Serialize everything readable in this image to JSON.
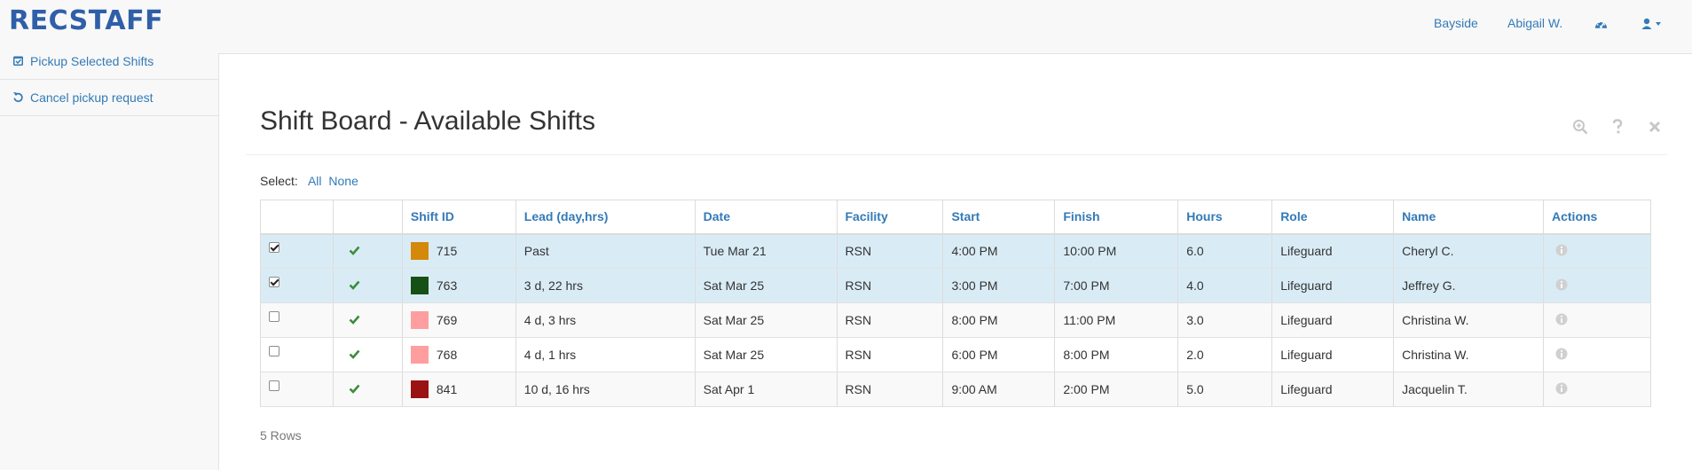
{
  "brand": "RECSTAFF",
  "nav": {
    "location": "Bayside",
    "user": "Abigail W."
  },
  "icons": {
    "pickup": "calendar-check-icon",
    "cancel": "undo-icon",
    "dashboard": "dashboard-icon",
    "user": "user-icon",
    "zoom": "zoom-in-icon",
    "help": "question-icon",
    "close": "close-icon",
    "check": "checkmark-icon",
    "info": "info-icon"
  },
  "sidebar": {
    "items": [
      {
        "label": "Pickup Selected Shifts"
      },
      {
        "label": "Cancel pickup request"
      }
    ]
  },
  "page": {
    "title": "Shift Board - Available Shifts",
    "select_label": "Select:",
    "select_all": "All",
    "select_none": "None",
    "row_count": "5 Rows"
  },
  "table": {
    "columns": [
      "",
      "",
      "Shift ID",
      "Lead (day,hrs)",
      "Date",
      "Facility",
      "Start",
      "Finish",
      "Hours",
      "Role",
      "Name",
      "Actions"
    ],
    "rows": [
      {
        "checked": true,
        "shift_id": "715",
        "color": "#d4890a",
        "lead": "Past",
        "date": "Tue Mar 21",
        "facility": "RSN",
        "start": "4:00 PM",
        "finish": "10:00 PM",
        "hours": "6.0",
        "role": "Lifeguard",
        "name": "Cheryl C."
      },
      {
        "checked": true,
        "shift_id": "763",
        "color": "#165016",
        "lead": "3 d, 22 hrs",
        "date": "Sat Mar 25",
        "facility": "RSN",
        "start": "3:00 PM",
        "finish": "7:00 PM",
        "hours": "4.0",
        "role": "Lifeguard",
        "name": "Jeffrey G."
      },
      {
        "checked": false,
        "shift_id": "769",
        "color": "#ff9e9e",
        "lead": "4 d, 3 hrs",
        "date": "Sat Mar 25",
        "facility": "RSN",
        "start": "8:00 PM",
        "finish": "11:00 PM",
        "hours": "3.0",
        "role": "Lifeguard",
        "name": "Christina W."
      },
      {
        "checked": false,
        "shift_id": "768",
        "color": "#ff9e9e",
        "lead": "4 d, 1 hrs",
        "date": "Sat Mar 25",
        "facility": "RSN",
        "start": "6:00 PM",
        "finish": "8:00 PM",
        "hours": "2.0",
        "role": "Lifeguard",
        "name": "Christina W."
      },
      {
        "checked": false,
        "shift_id": "841",
        "color": "#9a1212",
        "lead": "10 d, 16 hrs",
        "date": "Sat Apr 1",
        "facility": "RSN",
        "start": "9:00 AM",
        "finish": "2:00 PM",
        "hours": "5.0",
        "role": "Lifeguard",
        "name": "Jacquelin T."
      }
    ]
  },
  "colors": {
    "accent": "#337ab7",
    "brand": "#2f5fa8",
    "selected_row": "#d9ecf6",
    "check_green": "#3c8d3c"
  }
}
